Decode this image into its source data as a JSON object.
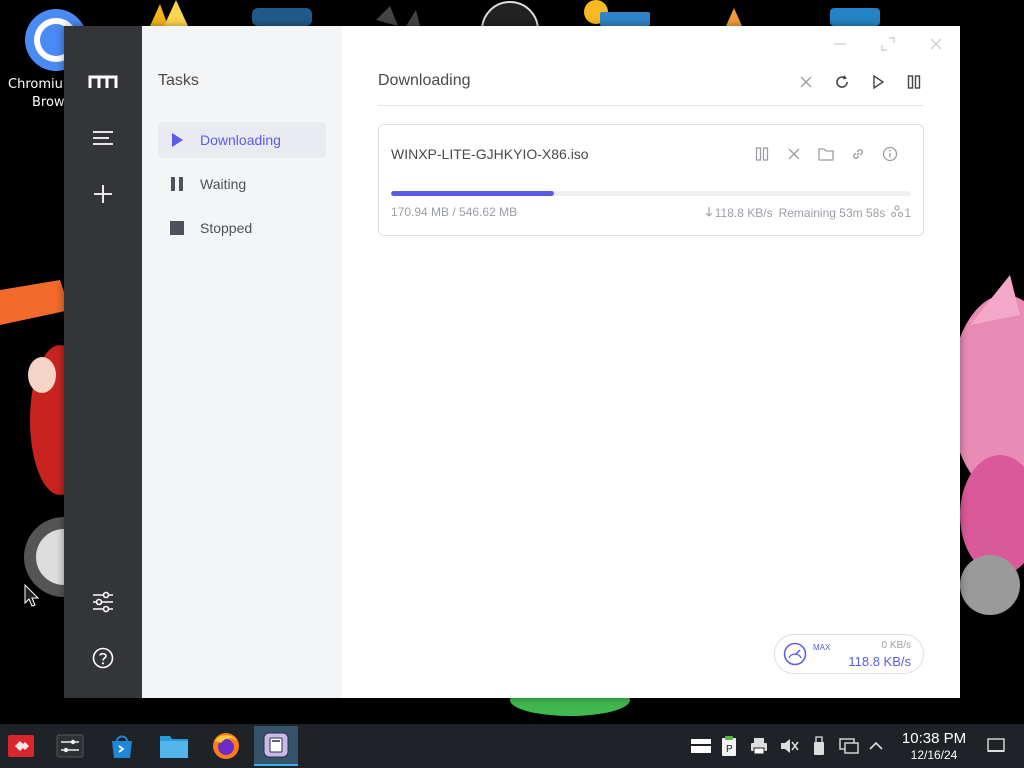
{
  "desktop": {
    "icons": [
      {
        "label": "Chromium Browser",
        "icon": "chromium-icon"
      }
    ],
    "chromium_label_line1": "Chromium",
    "chromium_label_line2": "Brows"
  },
  "app": {
    "sidebar_icons": [
      "logo-icon",
      "menu-icon",
      "add-icon",
      "preferences-icon",
      "help-icon"
    ],
    "subnav": {
      "title": "Tasks",
      "items": [
        {
          "label": "Downloading",
          "icon": "play-icon",
          "active": true
        },
        {
          "label": "Waiting",
          "icon": "pause-icon",
          "active": false
        },
        {
          "label": "Stopped",
          "icon": "stop-icon",
          "active": false
        }
      ]
    },
    "main": {
      "title": "Downloading",
      "toolbar_icons": [
        "close-icon",
        "refresh-icon",
        "play-icon",
        "pause-icon"
      ]
    },
    "task": {
      "name": "WINXP-LITE-GJHKYIO-X86.iso",
      "progress_fraction": 0.3127,
      "size": "170.94 MB / 546.62 MB",
      "speed": "118.8 KB/s",
      "remaining": "Remaining 53m 58s",
      "connections": "1",
      "action_icons": [
        "pause-icon",
        "close-icon",
        "folder-icon",
        "link-icon",
        "info-icon"
      ]
    },
    "speedometer": {
      "max_label": "MAX",
      "upload": "0 KB/s",
      "download": "118.8 KB/s"
    }
  },
  "taskbar": {
    "apps": [
      "application-launcher-icon",
      "settings-icon",
      "store-icon",
      "file-manager-icon",
      "firefox-icon",
      "motrix-icon"
    ],
    "tray_icons": [
      "display-icon",
      "clipboard-icon",
      "printer-icon",
      "volume-muted-icon",
      "usb-icon",
      "network-icon",
      "chevron-up-icon"
    ],
    "clock_time": "10:38 PM",
    "clock_date": "12/16/24"
  },
  "colors": {
    "accent": "#5b5bea",
    "sidebar": "#333538",
    "subnav": "#f4f5f7",
    "taskbar": "#1f2327"
  }
}
